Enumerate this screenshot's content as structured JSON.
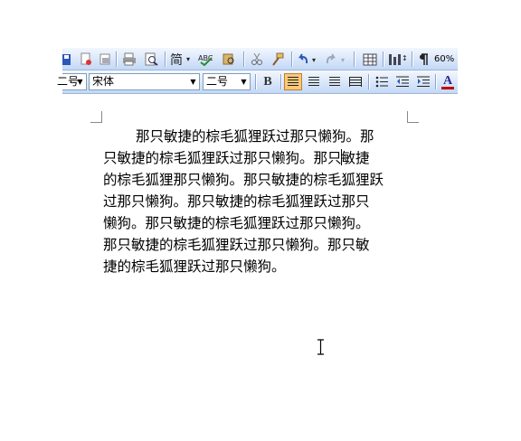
{
  "toolbar_standard": {
    "zoom_value": "60%",
    "icons": [
      "save-icon",
      "permission-icon",
      "print-icon",
      "print-preview-icon",
      "spelling-icon",
      "research-icon",
      "cut-icon",
      "format-painter-icon",
      "undo-icon",
      "redo-icon",
      "table-icon",
      "columns-icon",
      "show-formatting-icon"
    ]
  },
  "toolbar_formatting": {
    "size_left_value": "二号",
    "font_value": "宋体",
    "font_size_value": "二号",
    "bold_label": "B",
    "font_color_label": "A",
    "colors": {
      "accent_pressed": "#f9c87b",
      "font_color_bar": "#c00000"
    }
  },
  "document": {
    "lines": [
      "那只敏捷的棕毛狐狸跃过那只懒狗。那",
      "只敏捷的棕毛狐狸跃过那只懒狗。那只敏捷",
      "的棕毛狐狸那只懒狗。那只敏捷的棕毛狐狸跃",
      "过那只懒狗。那只敏捷的棕毛狐狸跃过那只",
      "懒狗。那只敏捷的棕毛狐狸跃过那只懒狗。",
      "那只敏捷的棕毛狐狸跃过那只懒狗。那只敏",
      "捷的棕毛狐狸跃过那只懒狗。"
    ]
  }
}
